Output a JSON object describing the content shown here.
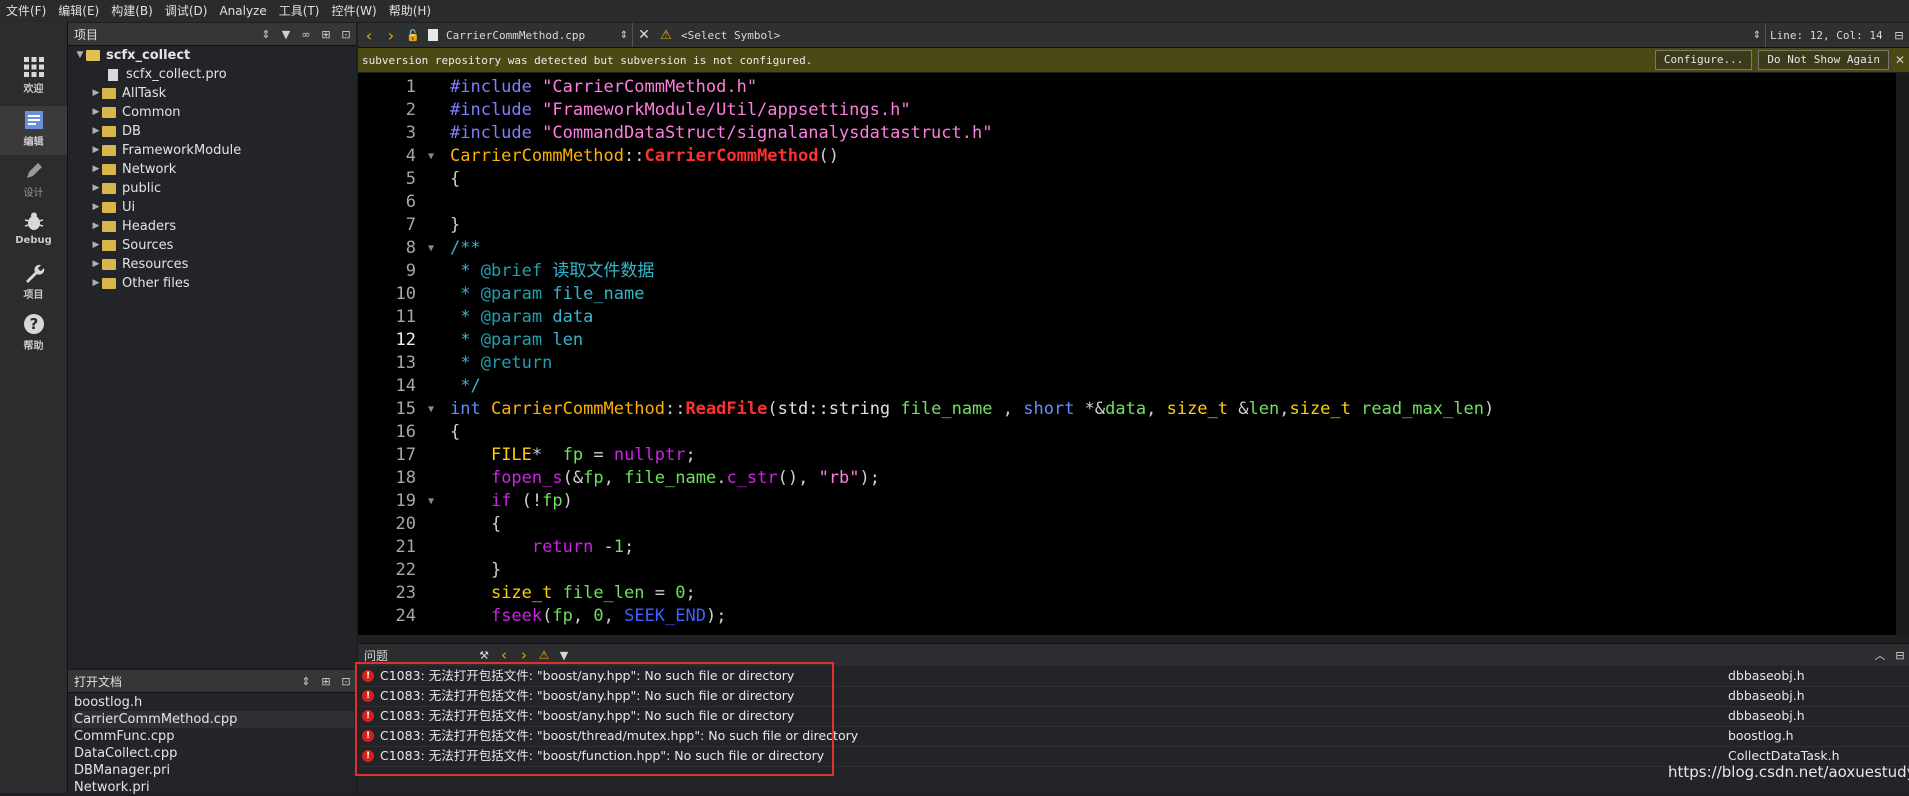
{
  "menubar": {
    "items": [
      "文件(F)",
      "编辑(E)",
      "构建(B)",
      "调试(D)",
      "Analyze",
      "工具(T)",
      "控件(W)",
      "帮助(H)"
    ]
  },
  "modes": [
    {
      "label": "欢迎",
      "icon": "grid-icon"
    },
    {
      "label": "编辑",
      "icon": "edit-document-icon"
    },
    {
      "label": "设计",
      "icon": "pencil-icon"
    },
    {
      "label": "Debug",
      "icon": "bug-icon"
    },
    {
      "label": "项目",
      "icon": "wrench-icon"
    },
    {
      "label": "帮助",
      "icon": "help-icon"
    }
  ],
  "project_panel": {
    "title": "项目",
    "root": "scfx_collect",
    "items": [
      {
        "label": "scfx_collect.pro",
        "kind": "file"
      },
      {
        "label": "AllTask",
        "kind": "folder"
      },
      {
        "label": "Common",
        "kind": "folder"
      },
      {
        "label": "DB",
        "kind": "folder"
      },
      {
        "label": "FrameworkModule",
        "kind": "folder"
      },
      {
        "label": "Network",
        "kind": "folder"
      },
      {
        "label": "public",
        "kind": "folder"
      },
      {
        "label": "Ui",
        "kind": "folder"
      },
      {
        "label": "Headers",
        "kind": "folder"
      },
      {
        "label": "Sources",
        "kind": "folder"
      },
      {
        "label": "Resources",
        "kind": "folder"
      },
      {
        "label": "Other files",
        "kind": "folder"
      }
    ]
  },
  "open_docs": {
    "title": "打开文档",
    "items": [
      "boostlog.h",
      "CarrierCommMethod.cpp",
      "CommFunc.cpp",
      "DataCollect.cpp",
      "DBManager.pri",
      "Network.pri"
    ],
    "selected_index": 1
  },
  "editor_toolbar": {
    "file": "CarrierCommMethod.cpp",
    "symbol": "<Select Symbol>",
    "position": "Line: 12, Col: 14"
  },
  "infobar": {
    "message": "subversion repository was detected but subversion is not configured.",
    "configure_label": "Configure...",
    "dismiss_label": "Do Not Show Again"
  },
  "editor": {
    "current_line": 12,
    "line_numbers": [
      "1",
      "2",
      "3",
      "4",
      "5",
      "6",
      "7",
      "8",
      "9",
      "10",
      "11",
      "12",
      "13",
      "14",
      "15",
      "16",
      "17",
      "18",
      "19",
      "20",
      "21",
      "22",
      "23",
      "24"
    ],
    "lines": [
      [
        [
          "pp",
          "#include "
        ],
        [
          "str",
          "\"CarrierCommMethod.h\""
        ]
      ],
      [
        [
          "pp",
          "#include "
        ],
        [
          "str",
          "\"FrameworkModule/Util/appsettings.h\""
        ]
      ],
      [
        [
          "pp",
          "#include "
        ],
        [
          "str",
          "\"CommandDataStruct/signalanalysdatastruct.h\""
        ]
      ],
      [
        [
          "cls",
          "CarrierCommMethod"
        ],
        [
          "op",
          "::"
        ],
        [
          "fn",
          "CarrierCommMethod"
        ],
        [
          "op",
          "()"
        ]
      ],
      [
        [
          "op",
          "{"
        ]
      ],
      [
        [
          "op",
          ""
        ]
      ],
      [
        [
          "op",
          "}"
        ]
      ],
      [
        [
          "cm",
          "/**"
        ]
      ],
      [
        [
          "cm",
          " * "
        ],
        [
          "tag",
          "@brief"
        ],
        [
          "cm",
          " 读取文件数据"
        ]
      ],
      [
        [
          "cm",
          " * "
        ],
        [
          "tag",
          "@param"
        ],
        [
          "cm",
          " file_name"
        ]
      ],
      [
        [
          "cm",
          " * "
        ],
        [
          "tag",
          "@param"
        ],
        [
          "cm",
          " data"
        ]
      ],
      [
        [
          "cm",
          " * "
        ],
        [
          "tag",
          "@param"
        ],
        [
          "cm",
          " len"
        ]
      ],
      [
        [
          "cm",
          " * "
        ],
        [
          "tag",
          "@return"
        ]
      ],
      [
        [
          "cm",
          " */"
        ]
      ],
      [
        [
          "type",
          "int "
        ],
        [
          "cls",
          "CarrierCommMethod"
        ],
        [
          "op",
          "::"
        ],
        [
          "fn",
          "ReadFile"
        ],
        [
          "op",
          "("
        ],
        [
          "std",
          "std::string "
        ],
        [
          "var",
          "file_name"
        ],
        [
          "op",
          " , "
        ],
        [
          "type",
          "short "
        ],
        [
          "op",
          "*&"
        ],
        [
          "var",
          "data"
        ],
        [
          "op",
          ", "
        ],
        [
          "id",
          "size_t "
        ],
        [
          "op",
          "&"
        ],
        [
          "var",
          "len"
        ],
        [
          "op",
          ","
        ],
        [
          "id",
          "size_t "
        ],
        [
          "var",
          "read_max_len"
        ],
        [
          "op",
          ")"
        ]
      ],
      [
        [
          "op",
          "{"
        ]
      ],
      [
        [
          "op",
          "    "
        ],
        [
          "id",
          "FILE"
        ],
        [
          "op",
          "*  "
        ],
        [
          "var",
          "fp"
        ],
        [
          "op",
          " = "
        ],
        [
          "kw",
          "nullptr"
        ],
        [
          "op",
          ";"
        ]
      ],
      [
        [
          "op",
          "    "
        ],
        [
          "kw",
          "fopen_s"
        ],
        [
          "op",
          "(&"
        ],
        [
          "var",
          "fp"
        ],
        [
          "op",
          ", "
        ],
        [
          "var",
          "file_name"
        ],
        [
          "op",
          "."
        ],
        [
          "kw",
          "c_str"
        ],
        [
          "op",
          "(), "
        ],
        [
          "str",
          "\"rb\""
        ],
        [
          "op",
          ");"
        ]
      ],
      [
        [
          "op",
          "    "
        ],
        [
          "kw",
          "if"
        ],
        [
          "op",
          " (!"
        ],
        [
          "var",
          "fp"
        ],
        [
          "op",
          ")"
        ]
      ],
      [
        [
          "op",
          "    {"
        ]
      ],
      [
        [
          "op",
          "        "
        ],
        [
          "kw",
          "return"
        ],
        [
          "op",
          " -"
        ],
        [
          "num",
          "1"
        ],
        [
          "op",
          ";"
        ]
      ],
      [
        [
          "op",
          "    }"
        ]
      ],
      [
        [
          "op",
          "    "
        ],
        [
          "id",
          "size_t "
        ],
        [
          "var",
          "file_len"
        ],
        [
          "op",
          " = "
        ],
        [
          "num",
          "0"
        ],
        [
          "op",
          ";"
        ]
      ],
      [
        [
          "op",
          "    "
        ],
        [
          "kw",
          "fseek"
        ],
        [
          "op",
          "("
        ],
        [
          "var",
          "fp"
        ],
        [
          "op",
          ", "
        ],
        [
          "num",
          "0"
        ],
        [
          "op",
          ", "
        ],
        [
          "macro",
          "SEEK_END"
        ],
        [
          "op",
          ");"
        ]
      ]
    ]
  },
  "issues": {
    "title": "问题",
    "rows": [
      {
        "message": "C1083: 无法打开包括文件: \"boost/any.hpp\": No such file or directory",
        "file": "dbbaseobj.h"
      },
      {
        "message": "C1083: 无法打开包括文件: \"boost/any.hpp\": No such file or directory",
        "file": "dbbaseobj.h"
      },
      {
        "message": "C1083: 无法打开包括文件: \"boost/any.hpp\": No such file or directory",
        "file": "dbbaseobj.h"
      },
      {
        "message": "C1083: 无法打开包括文件: \"boost/thread/mutex.hpp\": No such file or directory",
        "file": "boostlog.h"
      },
      {
        "message": "C1083: 无法打开包括文件: \"boost/function.hpp\": No such file or directory",
        "file": "CollectDataTask.h"
      }
    ]
  },
  "watermark": "https://blog.csdn.net/aoxuestudy",
  "colors": {
    "accent": "#e03030",
    "infobar": "#4c4a14",
    "editor_bg": "#000000"
  }
}
